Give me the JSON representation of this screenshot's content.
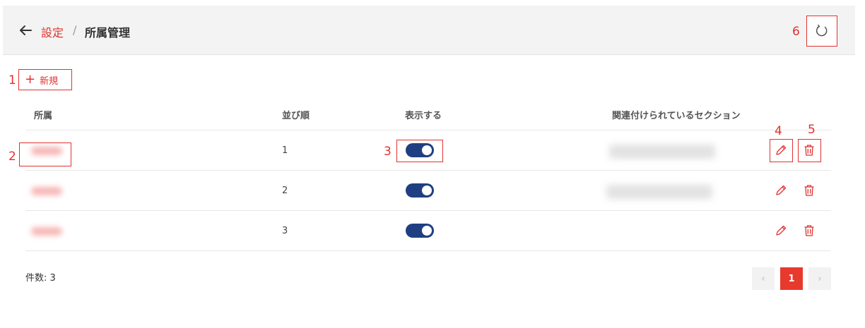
{
  "header": {
    "breadcrumb_parent": "設定",
    "breadcrumb_separator": "/",
    "breadcrumb_current": "所属管理"
  },
  "toolbar": {
    "add_label": "新規"
  },
  "table": {
    "columns": [
      "所属",
      "並び順",
      "表示する",
      "関連付けられているセクション"
    ],
    "rows": [
      {
        "order": "1",
        "visible": true
      },
      {
        "order": "2",
        "visible": true
      },
      {
        "order": "3",
        "visible": true
      }
    ]
  },
  "footer": {
    "count_text": "件数: 3"
  },
  "pagination": {
    "prev": "‹",
    "current_page": "1",
    "next": "›"
  },
  "annotations": [
    "1",
    "2",
    "3",
    "4",
    "5",
    "6"
  ],
  "colors": {
    "accent": "#e0322f",
    "toggle_on": "#1f3f82",
    "header_bg": "#f3f3f3"
  },
  "icons": [
    "back-arrow-icon",
    "refresh-icon",
    "plus-icon",
    "pencil-icon",
    "trash-icon"
  ]
}
